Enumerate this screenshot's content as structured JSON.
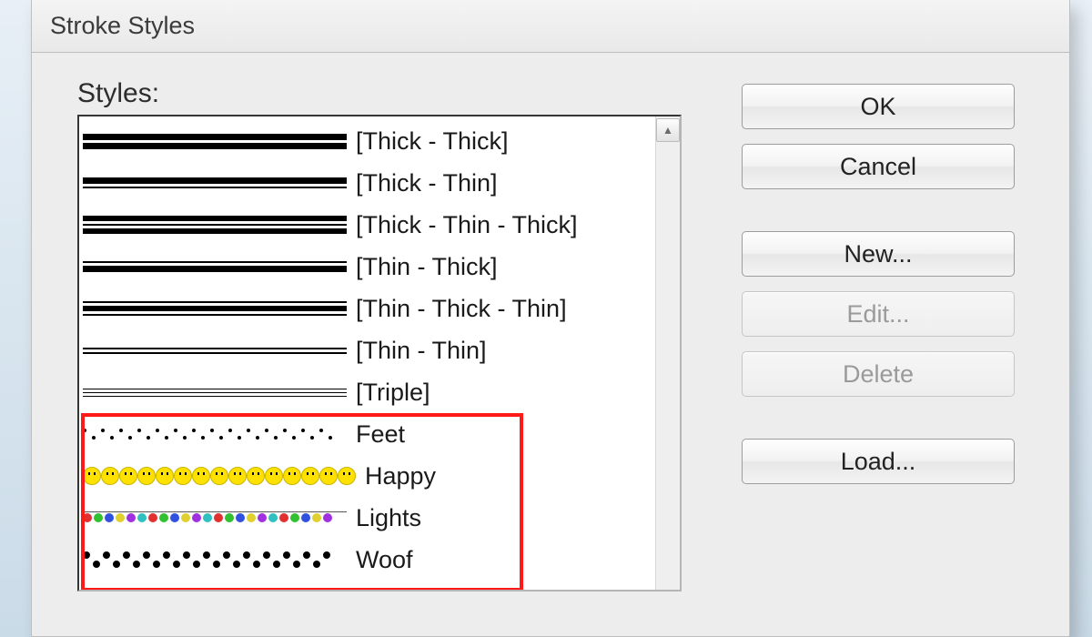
{
  "dialog": {
    "title": "Stroke Styles",
    "styles_label": "Styles:",
    "items": [
      {
        "label": "[Thick - Thick]",
        "type": "thick-thick"
      },
      {
        "label": "[Thick - Thin]",
        "type": "thick-thin"
      },
      {
        "label": "[Thick - Thin - Thick]",
        "type": "thick-thin-thick"
      },
      {
        "label": "[Thin - Thick]",
        "type": "thin-thick"
      },
      {
        "label": "[Thin - Thick - Thin]",
        "type": "thin-thick-thin"
      },
      {
        "label": "[Thin - Thin]",
        "type": "thin-thin"
      },
      {
        "label": "[Triple]",
        "type": "triple"
      },
      {
        "label": "Feet",
        "type": "feet"
      },
      {
        "label": "Happy",
        "type": "happy"
      },
      {
        "label": "Lights",
        "type": "lights"
      },
      {
        "label": "Woof",
        "type": "woof"
      }
    ],
    "buttons": {
      "ok": "OK",
      "cancel": "Cancel",
      "new": "New...",
      "edit": "Edit...",
      "delete": "Delete",
      "load": "Load..."
    },
    "disabled": {
      "edit": true,
      "delete": true
    }
  },
  "highlight": {
    "color": "#ff1a1a",
    "covers_indices": [
      7,
      8,
      9,
      10
    ]
  }
}
